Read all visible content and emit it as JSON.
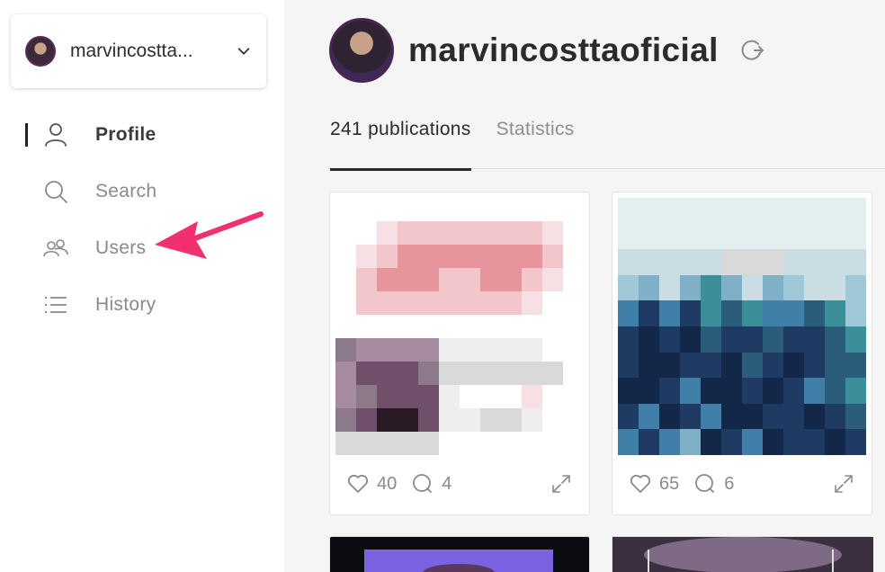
{
  "account": {
    "name": "marvincostta...",
    "avatar_icon": "user-avatar"
  },
  "nav": {
    "items": [
      {
        "label": "Profile",
        "icon": "user-icon",
        "active": true
      },
      {
        "label": "Search",
        "icon": "search-icon",
        "active": false
      },
      {
        "label": "Users",
        "icon": "users-icon",
        "active": false
      },
      {
        "label": "History",
        "icon": "list-icon",
        "active": false
      }
    ]
  },
  "profile": {
    "username": "marvincosttaoficial"
  },
  "tabs": [
    {
      "label": "241 publications",
      "active": true
    },
    {
      "label": "Statistics",
      "active": false
    }
  ],
  "posts": [
    {
      "likes": "40",
      "comments": "4"
    },
    {
      "likes": "65",
      "comments": "6"
    }
  ],
  "colors": {
    "accent_arrow": "#f0306f",
    "active_text": "#2b2b2b",
    "muted_text": "#8a8a8a"
  }
}
